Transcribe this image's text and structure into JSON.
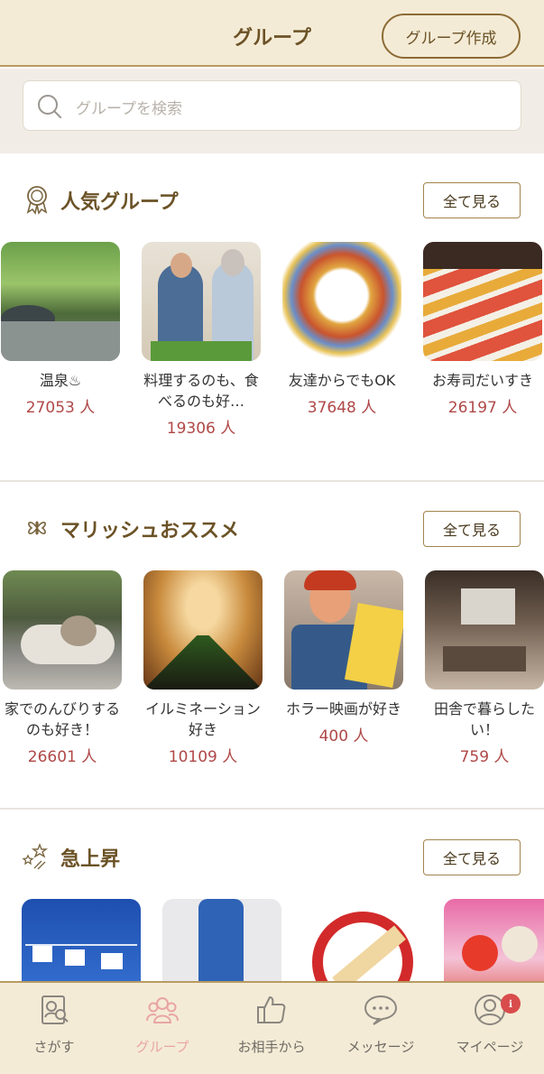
{
  "header": {
    "title": "グループ",
    "create_button": "グループ作成"
  },
  "search": {
    "placeholder": "グループを検索"
  },
  "sections": [
    {
      "title": "人気グループ",
      "icon": "award-ribbon-icon",
      "see_all": "全て見る",
      "groups": [
        {
          "name": "温泉♨",
          "count": "27053 人"
        },
        {
          "name": "料理するのも、食べるのも好…",
          "count": "19306 人"
        },
        {
          "name": "友達からでもOK",
          "count": "37648 人"
        },
        {
          "name": "お寿司だいすき",
          "count": "26197 人"
        }
      ]
    },
    {
      "title": "マリッシュおススメ",
      "icon": "clover-icon",
      "see_all": "全て見る",
      "groups": [
        {
          "name": "家でのんびりするのも好き！",
          "count": "26601 人"
        },
        {
          "name": "イルミネーション好き",
          "count": "10109 人"
        },
        {
          "name": "ホラー映画が好き",
          "count": "400 人"
        },
        {
          "name": "田舎で暮らしたい！",
          "count": "759 人"
        }
      ]
    },
    {
      "title": "急上昇",
      "icon": "sparkle-stars-icon",
      "see_all": "全て見る",
      "groups": []
    }
  ],
  "nav": {
    "items": [
      {
        "label": "さがす",
        "icon": "search-profile-icon"
      },
      {
        "label": "グループ",
        "icon": "group-people-icon",
        "active": true
      },
      {
        "label": "お相手から",
        "icon": "thumbs-up-icon"
      },
      {
        "label": "メッセージ",
        "icon": "message-bubble-icon"
      },
      {
        "label": "マイページ",
        "icon": "user-circle-icon",
        "badge": "ℹ︎"
      }
    ]
  },
  "colors": {
    "header_bg": "#f4ebd6",
    "accent_brown": "#6b5226",
    "count_red": "#b04848",
    "active_pink": "#e8a5a5"
  }
}
